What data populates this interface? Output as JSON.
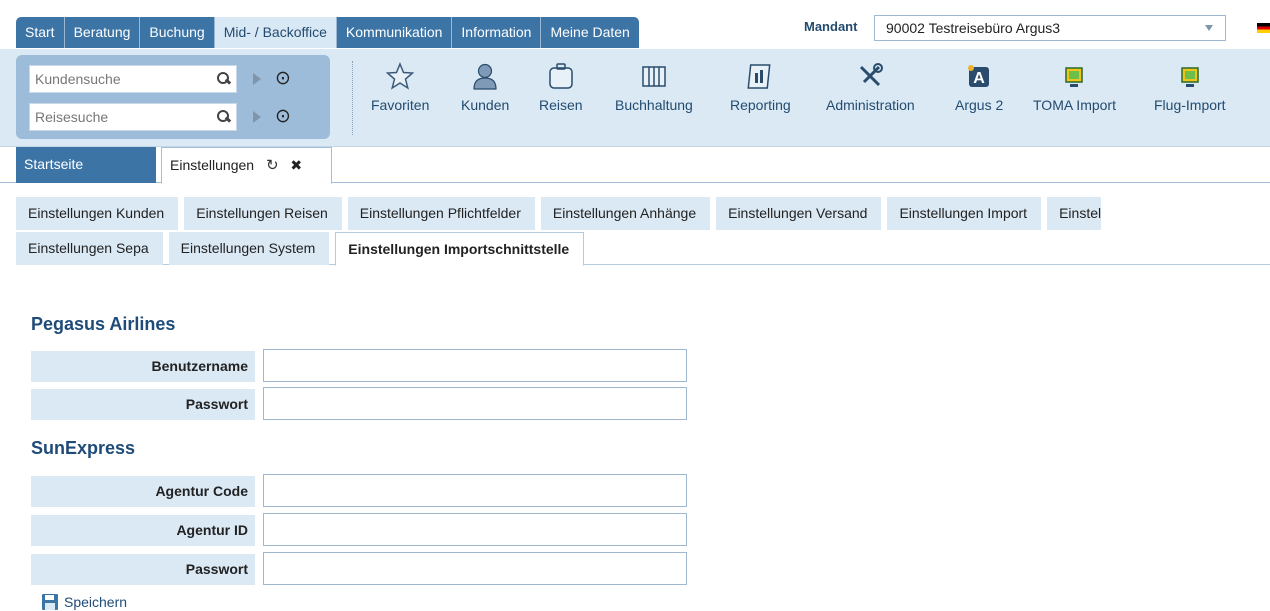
{
  "nav": {
    "tabs": [
      "Start",
      "Beratung",
      "Buchung",
      "Mid- / Backoffice",
      "Kommunikation",
      "Information",
      "Meine Daten"
    ],
    "active_tab": "Mid- / Backoffice",
    "mandant_label": "Mandant",
    "mandant_value": "90002 Testreisebüro Argus3"
  },
  "search": {
    "customer_placeholder": "Kundensuche",
    "travel_placeholder": "Reisesuche"
  },
  "toolbar": {
    "items": [
      {
        "label": "Favoriten",
        "icon": "star-icon"
      },
      {
        "label": "Kunden",
        "icon": "person-icon"
      },
      {
        "label": "Reisen",
        "icon": "suitcase-icon"
      },
      {
        "label": "Buchhaltung",
        "icon": "ledger-icon"
      },
      {
        "label": "Reporting",
        "icon": "report-icon"
      },
      {
        "label": "Administration",
        "icon": "tools-icon"
      },
      {
        "label": "Argus 2",
        "icon": "argus-icon"
      },
      {
        "label": "TOMA Import",
        "icon": "import-icon"
      },
      {
        "label": "Flug-Import",
        "icon": "import-icon"
      }
    ]
  },
  "doc_tabs": {
    "home": "Startseite",
    "settings": "Einstellungen"
  },
  "sub_tabs": {
    "row1": [
      "Einstellungen Kunden",
      "Einstellungen Reisen",
      "Einstellungen Pflichtfelder",
      "Einstellungen Anhänge",
      "Einstellungen Versand",
      "Einstellungen Import",
      "Einstel"
    ],
    "row2": [
      "Einstellungen Sepa",
      "Einstellungen System",
      "Einstellungen Importschnittstelle"
    ],
    "active": "Einstellungen Importschnittstelle"
  },
  "sections": {
    "pegasus": {
      "title": "Pegasus Airlines",
      "fields": [
        {
          "label": "Benutzername",
          "value": ""
        },
        {
          "label": "Passwort",
          "value": ""
        }
      ]
    },
    "sunexpress": {
      "title": "SunExpress",
      "fields": [
        {
          "label": "Agentur Code",
          "value": ""
        },
        {
          "label": "Agentur ID",
          "value": ""
        },
        {
          "label": "Passwort",
          "value": ""
        }
      ]
    }
  },
  "save_label": "Speichern"
}
